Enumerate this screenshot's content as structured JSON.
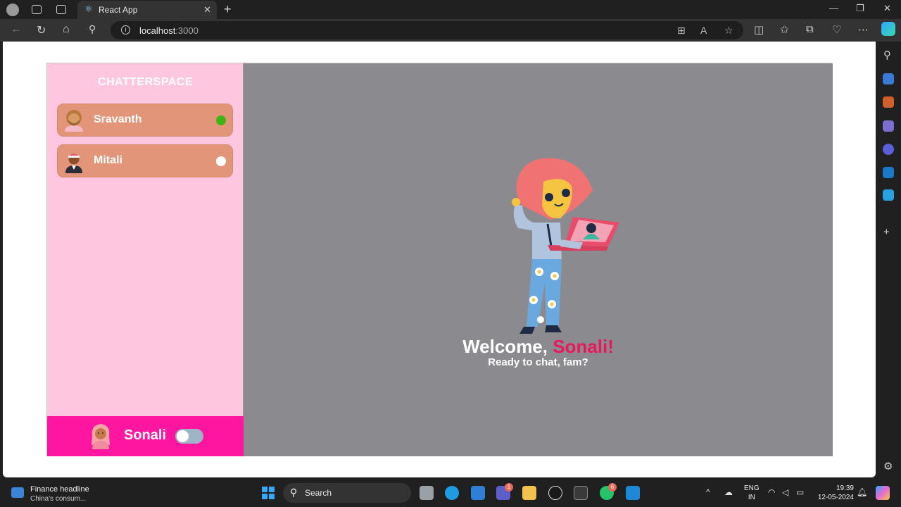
{
  "browser": {
    "tab_title": "React App",
    "url_host": "localhost",
    "url_port": ":3000"
  },
  "app": {
    "brand": "CHATTERSPACE",
    "contacts": [
      {
        "name": "Sravanth",
        "status": "online",
        "status_color": "#3cb515"
      },
      {
        "name": "Mitali",
        "status": "offline",
        "status_color": "#ffffff"
      }
    ],
    "current_user": {
      "name": "Sonali",
      "theme_toggle": "off"
    },
    "welcome": {
      "prefix": "Welcome, ",
      "name": "Sonali!",
      "subtitle": "Ready to chat, fam?"
    },
    "colors": {
      "sidebar_bg": "#ffc6df",
      "contact_bg": "#e3957a",
      "user_bar_bg": "#fe15a0",
      "main_bg": "#8b8a8f",
      "highlight": "#e8195b"
    }
  },
  "taskbar": {
    "news_title": "Finance headline",
    "news_sub": "China's consum...",
    "search_label": "Search",
    "lang_top": "ENG",
    "lang_bottom": "IN",
    "time": "19:39",
    "date": "12-05-2024",
    "teams_badge": "1",
    "whatsapp_badge": "6"
  }
}
